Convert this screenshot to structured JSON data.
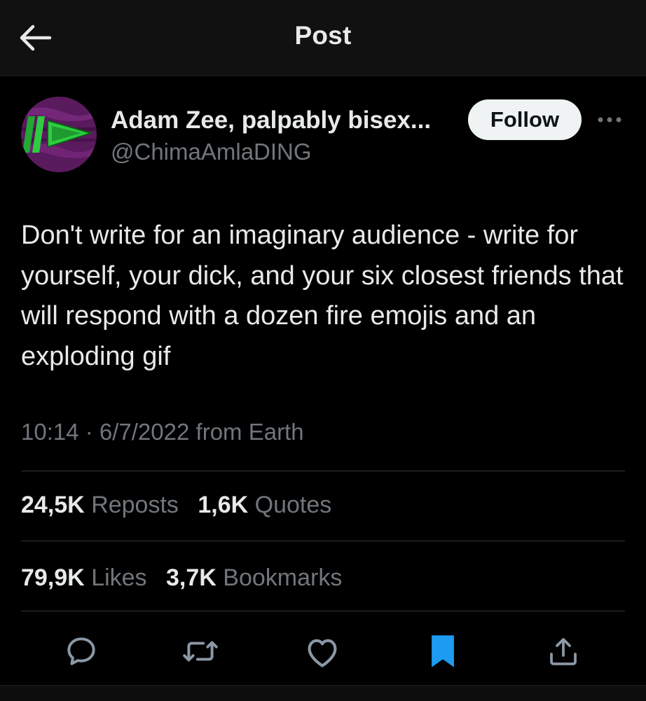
{
  "header": {
    "title": "Post",
    "back_icon": "arrow-left-icon"
  },
  "author": {
    "display_name": "Adam Zee, palpably bisex...",
    "handle": "@ChimaAmlaDING",
    "follow_label": "Follow",
    "more_icon": "more-dots-icon",
    "avatar_colors": {
      "background": "#6b1f6e",
      "accent": "#2ecc40"
    }
  },
  "post": {
    "text": "Don't write for an imaginary audience - write for yourself, your dick, and your six closest friends that will respond with a dozen fire emojis and an exploding gif",
    "timestamp": "10:14 · 6/7/2022 from Earth"
  },
  "stats": {
    "reposts": {
      "count": "24,5K",
      "label": "Reposts"
    },
    "quotes": {
      "count": "1,6K",
      "label": "Quotes"
    },
    "likes": {
      "count": "79,9K",
      "label": "Likes"
    },
    "bookmarks": {
      "count": "3,7K",
      "label": "Bookmarks"
    }
  },
  "actions": [
    {
      "icon": "reply-icon",
      "active": false
    },
    {
      "icon": "repost-icon",
      "active": false
    },
    {
      "icon": "like-icon",
      "active": false
    },
    {
      "icon": "bookmark-icon",
      "active": true,
      "color": "#1d9bf0"
    },
    {
      "icon": "share-icon",
      "active": false
    }
  ],
  "colors": {
    "text_primary": "#e7e9ea",
    "text_secondary": "#71767b",
    "accent": "#1d9bf0",
    "background": "#000000"
  }
}
